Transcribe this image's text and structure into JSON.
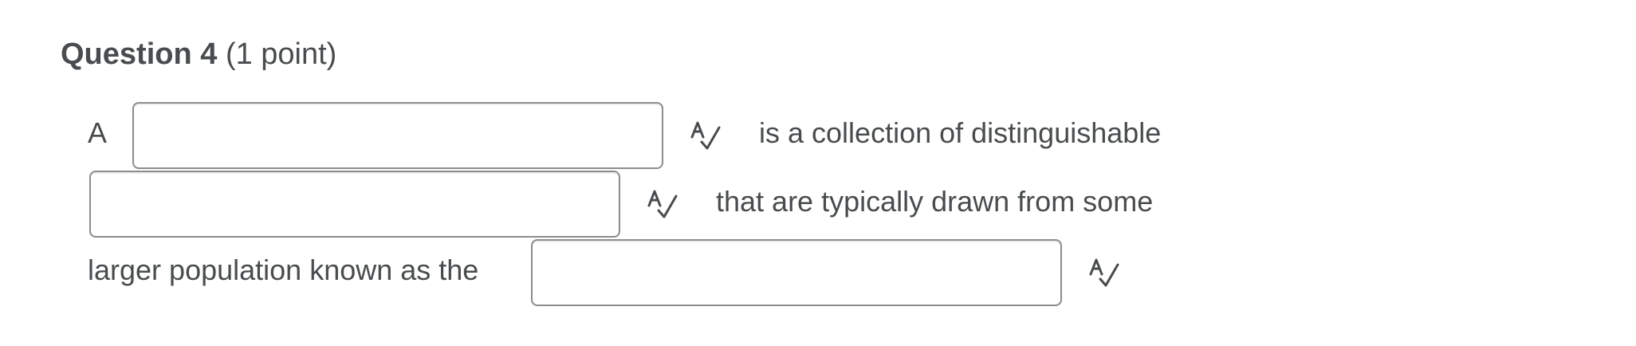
{
  "question": {
    "title": "Question 4",
    "points": "(1 point)"
  },
  "segments": {
    "s1": "A",
    "s2": "is a collection of distinguishable",
    "s3": "that are typically drawn from some",
    "s4": "larger population known as the"
  },
  "blanks": [
    {
      "value": "",
      "placeholder": ""
    },
    {
      "value": "",
      "placeholder": ""
    },
    {
      "value": "",
      "placeholder": ""
    }
  ],
  "icons": {
    "spellcheck": "spellcheck-icon"
  },
  "colors": {
    "text": "#494c4e",
    "border": "#8a8c8e"
  }
}
